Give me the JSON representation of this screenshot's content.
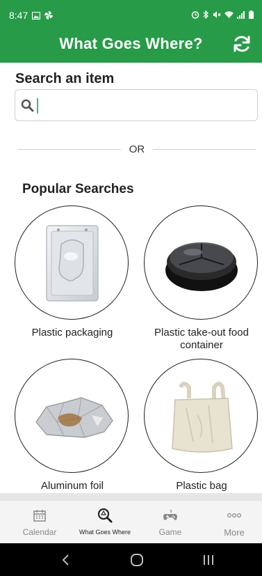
{
  "status": {
    "time": "8:47"
  },
  "app": {
    "title": "What Goes Where?"
  },
  "search": {
    "label": "Search an item",
    "placeholder": "",
    "value": ""
  },
  "divider_text": "OR",
  "popular": {
    "heading": "Popular Searches",
    "items": [
      {
        "label": "Plastic packaging"
      },
      {
        "label": "Plastic take-out food container"
      },
      {
        "label": "Aluminum foil"
      },
      {
        "label": "Plastic bag"
      }
    ]
  },
  "tabs": [
    {
      "label": "Calendar",
      "icon": "calendar-icon"
    },
    {
      "label": "What Goes Where",
      "icon": "search-recycle-icon",
      "active": true
    },
    {
      "label": "Game",
      "icon": "gamepad-icon"
    },
    {
      "label": "More",
      "icon": "more-dots-icon"
    }
  ],
  "colors": {
    "brand": "#279b48",
    "caret": "#2bbba0"
  }
}
